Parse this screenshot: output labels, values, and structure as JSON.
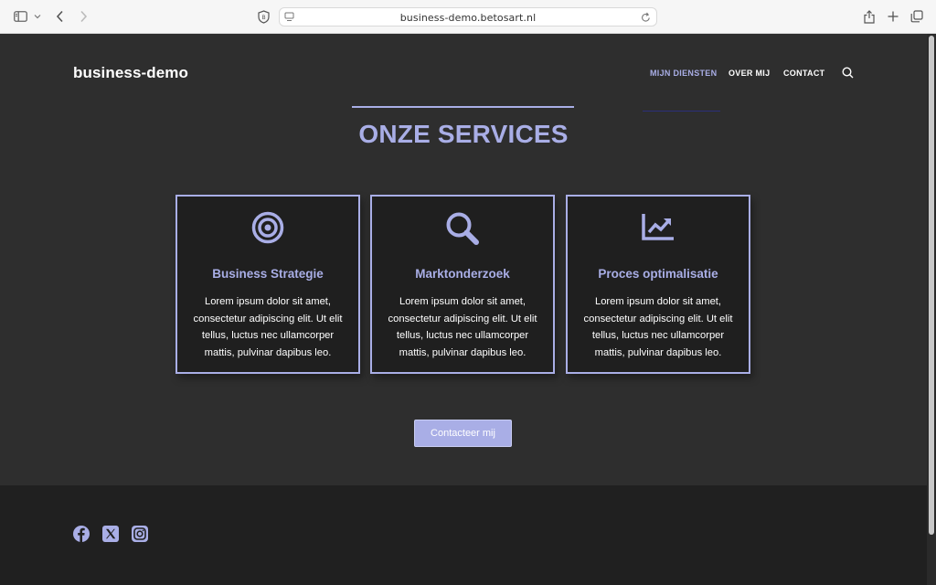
{
  "browser": {
    "url": "business-demo.betosart.nl",
    "icons": [
      "sidebar-icon",
      "chevron-down-icon",
      "back-icon",
      "forward-icon",
      "shield-icon",
      "page-icon",
      "reload-icon",
      "share-icon",
      "plus-icon",
      "tabs-icon"
    ]
  },
  "site": {
    "logo": "business-demo",
    "nav": [
      {
        "label": "MIJN DIENSTEN",
        "active": true
      },
      {
        "label": "OVER MIJ",
        "active": false
      },
      {
        "label": "CONTACT",
        "active": false
      }
    ]
  },
  "section": {
    "title": "ONZE SERVICES",
    "cards": [
      {
        "icon": "target-icon",
        "title": "Business Strategie",
        "text": "Lorem ipsum dolor sit amet, consectetur adipiscing elit. Ut elit tellus, luctus nec ullamcorper mattis, pulvinar dapibus leo."
      },
      {
        "icon": "search-icon",
        "title": "Marktonderzoek",
        "text": "Lorem ipsum dolor sit amet, consectetur adipiscing elit. Ut elit tellus, luctus nec ullamcorper mattis, pulvinar dapibus leo."
      },
      {
        "icon": "chart-line-icon",
        "title": "Proces optimalisatie",
        "text": "Lorem ipsum dolor sit amet, consectetur adipiscing elit. Ut elit tellus, luctus nec ullamcorper mattis, pulvinar dapibus leo."
      }
    ],
    "cta_label": "Contacteer mij"
  },
  "footer": {
    "social": [
      "facebook-icon",
      "x-icon",
      "instagram-icon"
    ]
  },
  "colors": {
    "accent": "#a9aee6",
    "background": "#2e2e2e",
    "card": "#1f1f1f",
    "footer": "#202020"
  }
}
